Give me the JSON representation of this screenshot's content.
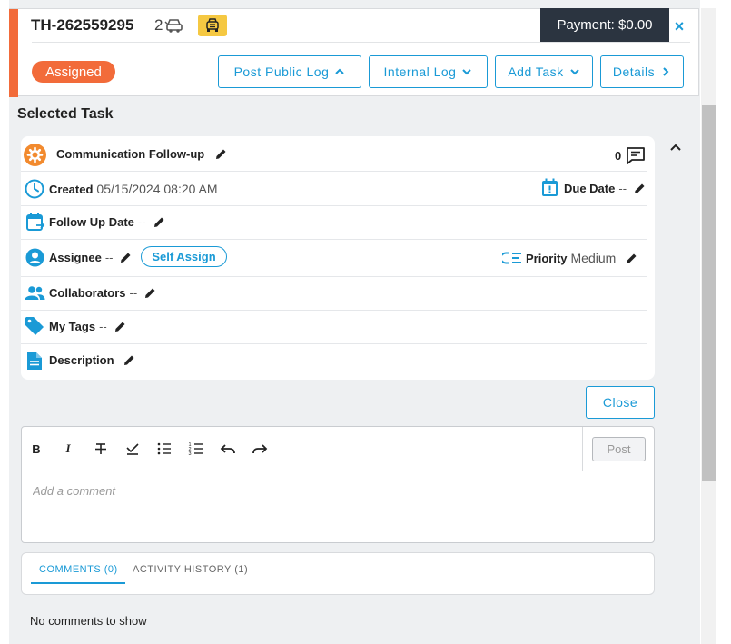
{
  "header": {
    "ticket_id": "TH-262559295",
    "vehicle_count": "2",
    "payment_label": "Payment: $0.00",
    "close_symbol": "×",
    "status": "Assigned",
    "buttons": {
      "post_public_log": "Post Public Log",
      "internal_log": "Internal Log",
      "add_task": "Add Task",
      "details": "Details"
    }
  },
  "task": {
    "section_title": "Selected Task",
    "title": "Communication Follow-up",
    "comment_count": "0",
    "created_label": "Created",
    "created_value": "05/15/2024 08:20 AM",
    "due_label": "Due Date",
    "due_value": "--",
    "follow_up_label": "Follow Up Date",
    "follow_up_value": "--",
    "assignee_label": "Assignee",
    "assignee_value": "--",
    "self_assign": "Self Assign",
    "priority_label": "Priority",
    "priority_value": "Medium",
    "collaborators_label": "Collaborators",
    "collaborators_value": "--",
    "tags_label": "My Tags",
    "tags_value": "--",
    "description_label": "Description",
    "close_button": "Close"
  },
  "editor": {
    "toolbar": {
      "bold": "B",
      "italic": "I"
    },
    "post_button": "Post",
    "placeholder": "Add a comment"
  },
  "tabs": {
    "comments": "COMMENTS (0)",
    "activity": "ACTIVITY HISTORY (1)",
    "empty_message": "No comments to show"
  },
  "colors": {
    "accent": "#1a9ad6",
    "status": "#f26b3a",
    "task_icon": "#f28a2e",
    "payment_bg": "#2b3440",
    "tow_badge": "#f5c842"
  }
}
